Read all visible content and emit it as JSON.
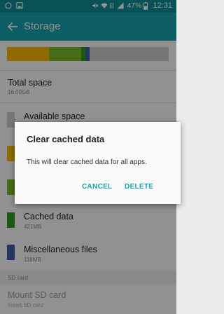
{
  "status_bar": {
    "battery": "47%",
    "time": "12:31",
    "notification_icons": [
      "whatsapp-icon",
      "image-icon"
    ],
    "system_icons": [
      "mute-icon",
      "wifi-icon",
      "sim-icon",
      "signal-icon",
      "battery-icon"
    ]
  },
  "app_bar": {
    "title": "Storage",
    "back_icon": "arrow-left-icon"
  },
  "storage_bar": {
    "segments": [
      {
        "name": "system",
        "color": "#f5b800",
        "fraction": 0.26
      },
      {
        "name": "apps",
        "color": "#7cbb2a",
        "fraction": 0.2
      },
      {
        "name": "cached",
        "color": "#2e9c1f",
        "fraction": 0.025
      },
      {
        "name": "misc",
        "color": "#3a5ea8",
        "fraction": 0.025
      }
    ],
    "free_color": "#c8cccd"
  },
  "total_space": {
    "label": "Total space",
    "value": "16.00GB"
  },
  "available_space": {
    "label": "Available space",
    "color": "#c8cccd"
  },
  "hidden_rows": [
    {
      "color": "#f5b800"
    },
    {
      "color": "#7cbb2a"
    }
  ],
  "cached_data": {
    "label": "Cached data",
    "value": "421MB",
    "color": "#2e9c1f"
  },
  "misc_files": {
    "label": "Miscellaneous files",
    "value": "118MB",
    "color": "#3a5ea8"
  },
  "sd_card": {
    "section": "SD card",
    "mount_label": "Mount SD card",
    "mount_sub": "Insert SD card"
  },
  "dialog": {
    "title": "Clear cached data",
    "message": "This will clear cached data for all apps.",
    "cancel": "CANCEL",
    "delete": "DELETE"
  }
}
